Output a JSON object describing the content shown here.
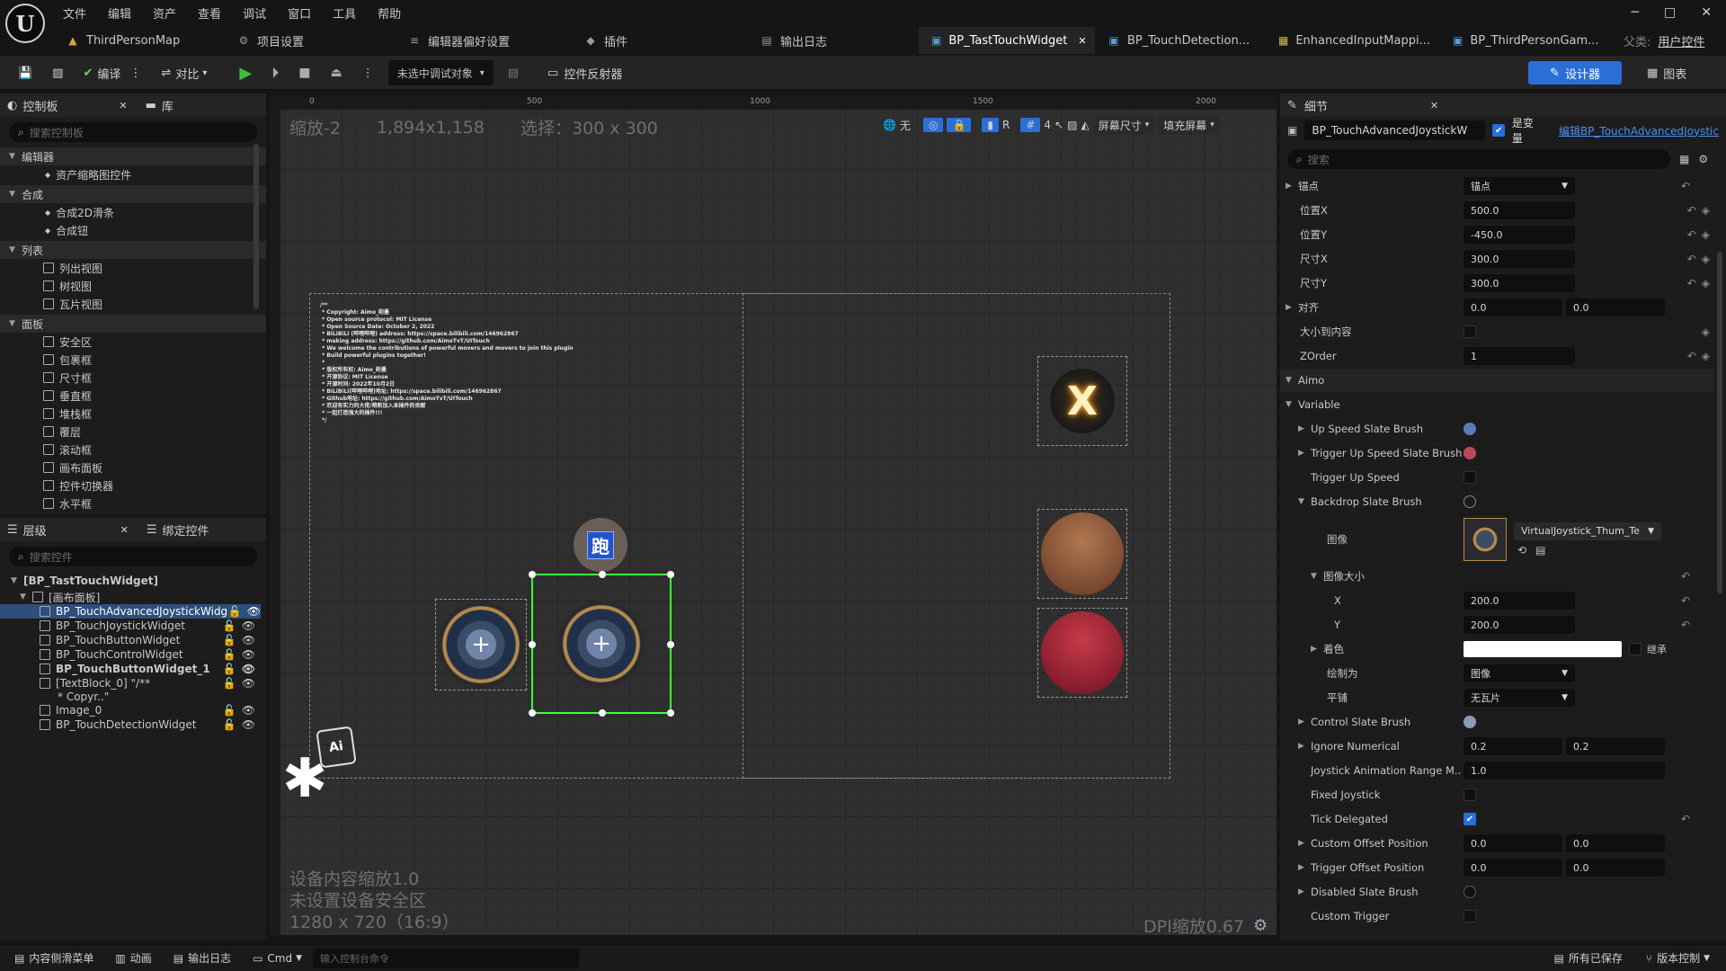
{
  "menu": [
    "文件",
    "编辑",
    "资产",
    "查看",
    "调试",
    "窗口",
    "工具",
    "帮助"
  ],
  "window": {
    "logo": "U",
    "min": "─",
    "max": "□",
    "close": "✕"
  },
  "tabs": [
    {
      "label": "ThirdPersonMap",
      "icon": "level-icon"
    },
    {
      "label": "项目设置",
      "icon": "settings-icon"
    },
    {
      "label": "编辑器偏好设置",
      "icon": "sliders-icon"
    },
    {
      "label": "插件",
      "icon": "plugin-icon"
    },
    {
      "label": "输出日志",
      "icon": "log-icon"
    },
    {
      "label": "BP_TastTouchWidget",
      "icon": "widget-icon",
      "active": true
    },
    {
      "label": "BP_TouchDetection...",
      "icon": "widget-icon"
    },
    {
      "label": "EnhancedInputMappi...",
      "icon": "input-icon"
    },
    {
      "label": "BP_ThirdPersonGam...",
      "icon": "blueprint-icon"
    }
  ],
  "parent": {
    "label": "父类:",
    "value": "用户控件"
  },
  "toolbar": {
    "compile": "编译",
    "diff": "对比",
    "debug_target": "未选中调试对象",
    "reflector": "控件反射器",
    "designer": "设计器",
    "graph": "图表"
  },
  "palette": {
    "tab1": "控制板",
    "tab2": "库",
    "search": "搜索控制板",
    "groups": [
      {
        "name": "编辑器",
        "items": [
          "资产缩略图控件"
        ]
      },
      {
        "name": "合成",
        "items": [
          "合成2D滑条",
          "合成钮"
        ]
      },
      {
        "name": "列表",
        "items": [
          "列出视图",
          "树视图",
          "瓦片视图"
        ]
      },
      {
        "name": "面板",
        "items": [
          "安全区",
          "包裹框",
          "尺寸框",
          "垂直框",
          "堆栈框",
          "覆层",
          "滚动框",
          "画布面板",
          "控件切换器",
          "水平框"
        ]
      }
    ]
  },
  "hierarchy": {
    "tab1": "层级",
    "tab2": "绑定控件",
    "search": "搜索控件",
    "root": "[BP_TastTouchWidget]",
    "canvas": "[画布面板]",
    "items": [
      "BP_TouchAdvancedJoystickWidg",
      "BP_TouchJoystickWidget",
      "BP_TouchButtonWidget",
      "BP_TouchControlWidget",
      "BP_TouchButtonWidget_1",
      "[TextBlock_0] \"/**",
      "* Copyr..\"",
      "Image_0",
      "BP_TouchDetectionWidget"
    ]
  },
  "canvas": {
    "zoom": "缩放-2",
    "resolution": "1,894x1,158",
    "selection": "选择：300 x 300",
    "ruler_marks": [
      "0",
      "500",
      "1000",
      "1500",
      "2000"
    ],
    "screen_size": "屏幕尺寸",
    "fill": "填充屏幕",
    "none": "无",
    "r": "R",
    "grid": "4",
    "device_scale": "设备内容缩放1.0",
    "safe_zone": "未设置设备安全区",
    "res_ratio": "1280 x 720（16:9）",
    "dpi": "DPI缩放0.67",
    "copyright": "/**\n * Copyright: Aimo_皑墨\n * Open source protocol: MIT License\n * Open Source Date: October 2, 2022\n * BiLiBiLi (哔哩哔哩) address: https://space.bilibili.com/146962867\n * making address: https://github.com/AimoTvT/UITouch\n * We welcome the contributions of powerful movers and movers to join this plugin\n * Build powerful plugins together!\n *\n * 版权所有权: Aimo_皑墨\n * 开源协议: MIT License\n * 开源时间: 2022年10月2日\n * BiLiBiLi(哔哩哔哩)地址: https://space.bilibili.com/146962867\n * Github地址: https://github.com/AimoTvT/UITouch\n * 欢迎有实力的大佬/萌新加入本插件的贡献\n * 一起打造强大的插件!!!\n */",
    "run_label": "跑",
    "x_label": "X",
    "ai_label": "Ai"
  },
  "details": {
    "tab": "细节",
    "name": "BP_TouchAdvancedJoystickW",
    "is_var": "是变量",
    "edit_link": "编辑BP_TouchAdvancedJoystic",
    "search": "搜索",
    "rows": [
      {
        "label": "锚点",
        "type": "dd",
        "value": "锚点",
        "expand": true
      },
      {
        "label": "位置X",
        "type": "num",
        "value": "500.0"
      },
      {
        "label": "位置Y",
        "type": "num",
        "value": "-450.0"
      },
      {
        "label": "尺寸X",
        "type": "num",
        "value": "300.0"
      },
      {
        "label": "尺寸Y",
        "type": "num",
        "value": "300.0"
      },
      {
        "label": "对齐",
        "type": "pair",
        "value": "0.0",
        "value2": "0.0",
        "expand": true
      },
      {
        "label": "大小到内容",
        "type": "chk",
        "value": ""
      },
      {
        "label": "ZOrder",
        "type": "num",
        "value": "1"
      }
    ],
    "section_aimo": "Aimo",
    "section_variable": "Variable",
    "vrows": [
      {
        "label": "Up Speed Slate Brush",
        "type": "brush",
        "expand": true
      },
      {
        "label": "Trigger Up Speed Slate Brush",
        "type": "brush",
        "expand": true
      },
      {
        "label": "Trigger Up Speed",
        "type": "chk"
      },
      {
        "label": "Backdrop Slate Brush",
        "type": "brush",
        "expand": true,
        "open": true
      }
    ],
    "image_label": "图像",
    "image_asset": "VirtualJoystick_Thum_Te",
    "image_size": "图像大小",
    "x": "X",
    "x_val": "200.0",
    "y": "Y",
    "y_val": "200.0",
    "tint": "着色",
    "inherit": "继承",
    "draw_as": "绘制为",
    "draw_as_val": "图像",
    "tiling": "平铺",
    "tiling_val": "无瓦片",
    "vrows2": [
      {
        "label": "Control Slate Brush",
        "type": "brush",
        "expand": true
      },
      {
        "label": "Ignore Numerical",
        "type": "pair",
        "value": "0.2",
        "value2": "0.2",
        "expand": true
      },
      {
        "label": "Joystick Animation Range M..",
        "type": "num",
        "value": "1.0"
      },
      {
        "label": "Fixed Joystick",
        "type": "chk"
      },
      {
        "label": "Tick Delegated",
        "type": "chkon"
      },
      {
        "label": "Custom Offset Position",
        "type": "pair",
        "value": "0.0",
        "value2": "0.0",
        "expand": true
      },
      {
        "label": "Trigger Offset Position",
        "type": "pair",
        "value": "0.0",
        "value2": "0.0",
        "expand": true
      },
      {
        "label": "Disabled Slate Brush",
        "type": "brush",
        "expand": true
      },
      {
        "label": "Custom Trigger",
        "type": "chk"
      }
    ]
  },
  "status": {
    "drawer": "内容侧滑菜单",
    "anim": "动画",
    "log": "输出日志",
    "cmd": "Cmd",
    "console": "输入控制台命令",
    "saved": "所有已保存",
    "vcs": "版本控制"
  },
  "colors": {
    "accent": "#2a6fd8",
    "selection": "#3cff3c",
    "active_tab": "#242424"
  }
}
